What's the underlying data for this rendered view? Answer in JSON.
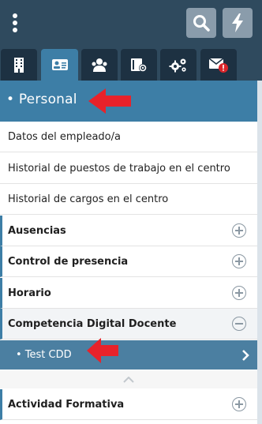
{
  "header": {
    "menu_icon": "vertical-dots-icon",
    "search_icon": "search-icon",
    "quick_icon": "lightning-icon"
  },
  "tabs": [
    {
      "icon": "building-icon",
      "active": false
    },
    {
      "icon": "id-card-icon",
      "active": true
    },
    {
      "icon": "users-icon",
      "active": false
    },
    {
      "icon": "book-settings-icon",
      "active": false
    },
    {
      "icon": "gears-icon",
      "active": false
    },
    {
      "icon": "mail-alert-icon",
      "active": false,
      "badge": "!"
    }
  ],
  "section": {
    "title": "• Personal"
  },
  "items": [
    {
      "label": "Datos del empleado/a"
    },
    {
      "label": "Historial de puestos de trabajo en el centro"
    },
    {
      "label": "Historial de cargos en el centro"
    }
  ],
  "groups": [
    {
      "label": "Ausencias",
      "state": "collapsed"
    },
    {
      "label": "Control de presencia",
      "state": "collapsed"
    },
    {
      "label": "Horario",
      "state": "collapsed"
    },
    {
      "label": "Competencia Digital Docente",
      "state": "expanded"
    }
  ],
  "subitem": {
    "label": "• Test CDD"
  },
  "after_group": {
    "label": "Actividad Formativa",
    "state": "collapsed"
  },
  "colors": {
    "header_bg": "#2f4a5e",
    "accent": "#3d7ea6",
    "annotation_arrow": "#e8222a"
  }
}
